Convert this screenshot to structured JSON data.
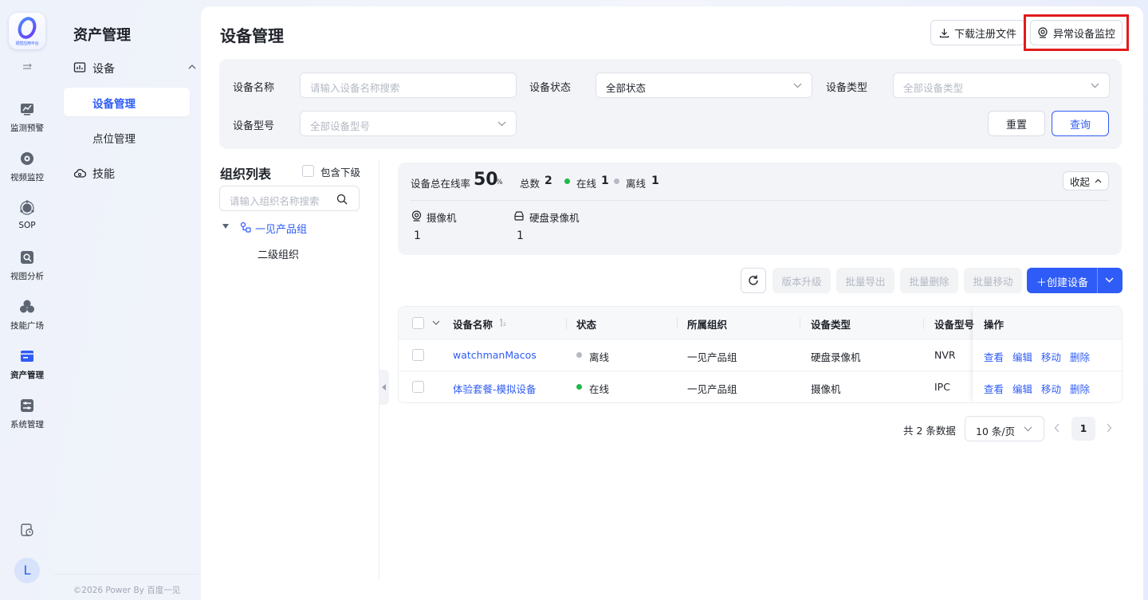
{
  "app": {
    "logo_caption": "视觉应用平台"
  },
  "rail": {
    "items": [
      {
        "label": "监测预警",
        "icon": "monitor-chart-icon"
      },
      {
        "label": "视频监控",
        "icon": "video-icon"
      },
      {
        "label": "SOP",
        "icon": "sop-icon"
      },
      {
        "label": "视图分析",
        "icon": "view-analysis-icon"
      },
      {
        "label": "技能广场",
        "icon": "skills-square-icon"
      },
      {
        "label": "资产管理",
        "icon": "asset-icon",
        "active": true
      },
      {
        "label": "系统管理",
        "icon": "system-settings-icon"
      }
    ],
    "avatar": "L"
  },
  "submenu": {
    "title": "资产管理",
    "group_label": "设备",
    "items": [
      "设备管理",
      "点位管理"
    ],
    "skill_label": "技能",
    "copyright": "©2026 Power By 百度一见"
  },
  "header": {
    "title": "设备管理",
    "download_label": "下载注册文件",
    "abnormal_label": "异常设备监控"
  },
  "filter": {
    "name_label": "设备名称",
    "name_placeholder": "请输入设备名称搜索",
    "status_label": "设备状态",
    "status_value": "全部状态",
    "type_label": "设备类型",
    "type_placeholder": "全部设备类型",
    "model_label": "设备型号",
    "model_placeholder": "全部设备型号",
    "reset_label": "重置",
    "query_label": "查询"
  },
  "org": {
    "title": "组织列表",
    "include_label": "包含下级",
    "search_placeholder": "请输入组织名称搜索",
    "nodes": [
      "一见产品组",
      "二级组织"
    ]
  },
  "stats": {
    "online_rate_label": "设备总在线率",
    "online_rate": "50",
    "online_rate_unit": "%",
    "total_label": "总数",
    "total": "2",
    "online_label": "在线",
    "online": "1",
    "offline_label": "离线",
    "offline": "1",
    "collapse_label": "收起",
    "types": [
      {
        "label": "摄像机",
        "count": "1"
      },
      {
        "label": "硬盘录像机",
        "count": "1"
      }
    ]
  },
  "toolbar": {
    "upgrade": "版本升级",
    "export": "批量导出",
    "delete": "批量删除",
    "move": "批量移动",
    "create": "创建设备"
  },
  "table": {
    "headers": [
      "设备名称",
      "状态",
      "所属组织",
      "设备类型",
      "设备型号",
      "操作"
    ],
    "rows": [
      {
        "name": "watchmanMacos",
        "status": "离线",
        "status_color": "#b4b9c3",
        "org": "一见产品组",
        "type": "硬盘录像机",
        "model": "NVR"
      },
      {
        "name": "体验套餐-模拟设备",
        "status": "在线",
        "status_color": "#20b94b",
        "org": "一见产品组",
        "type": "摄像机",
        "model": "IPC"
      }
    ],
    "ops": [
      "查看",
      "编辑",
      "移动",
      "删除"
    ]
  },
  "pager": {
    "total": "共 2 条数据",
    "page_size": "10 条/页",
    "current": "1"
  },
  "colors": {
    "accent": "#2f5cf6",
    "online": "#20b94b",
    "offline": "#b4b9c3",
    "highlight": "#e11b1b"
  }
}
